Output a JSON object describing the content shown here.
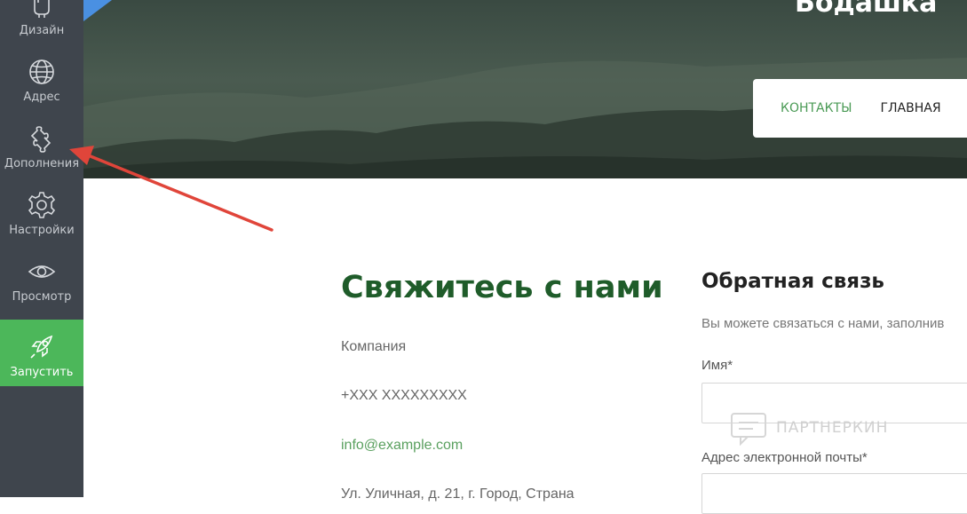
{
  "sidebar": {
    "items": [
      {
        "label": "Дизайн",
        "icon": "paint-bucket-icon"
      },
      {
        "label": "Адрес",
        "icon": "globe-icon"
      },
      {
        "label": "Дополнения",
        "icon": "puzzle-icon"
      },
      {
        "label": "Настройки",
        "icon": "gear-icon"
      },
      {
        "label": "Просмотр",
        "icon": "eye-icon"
      },
      {
        "label": "Запустить",
        "icon": "rocket-icon"
      }
    ]
  },
  "header": {
    "site_title": "Бодашка",
    "nav": [
      "КОНТАКТЫ",
      "ГЛАВНАЯ"
    ]
  },
  "contact": {
    "title": "Свяжитесь с нами",
    "company": "Компания",
    "phone": "+XXX XXXXXXXXX",
    "email": "info@example.com",
    "address": "Ул. Уличная, д. 21, г. Город, Страна"
  },
  "feedback": {
    "title": "Обратная связь",
    "description": "Вы можете связаться с нами, заполнив",
    "name_label": "Имя*",
    "email_label": "Адрес электронной почты*"
  },
  "watermark": {
    "text": "ПАРТНЕРКИН"
  },
  "colors": {
    "sidebar_bg": "#3f454d",
    "active_green": "#4cb75a",
    "title_green": "#1f5c2a",
    "annotation_arrow": "#e0453a"
  }
}
